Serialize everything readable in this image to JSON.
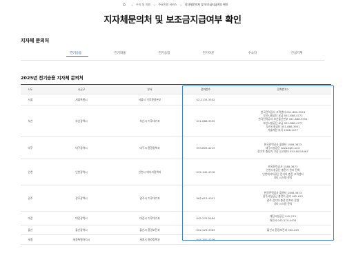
{
  "breadcrumb": {
    "home_icon": "⌂",
    "items": [
      "우리 동 지원",
      "주요민원 서비스",
      "지자체문의처 및 보조금지급여부 확인"
    ]
  },
  "page_title": "지자체문의처 및 보조금지급여부 확인",
  "section_title": "지자체 문의처",
  "tabs": [
    {
      "label": "전기승용",
      "active": true
    },
    {
      "label": "전기화물",
      "active": false
    },
    {
      "label": "전기승합",
      "active": false
    },
    {
      "label": "전기이륜",
      "active": false
    },
    {
      "label": "수소차",
      "active": false
    },
    {
      "label": "건설기계",
      "active": false
    }
  ],
  "table_title": "2025년 전기승용 지자체 문의처",
  "columns": [
    "시도",
    "시군구",
    "부서",
    "전화번호",
    "전화번호2"
  ],
  "rows": [
    {
      "area": "서울",
      "org": "서울특별시",
      "dept": "서울시 기후환경본부",
      "phone": "02-2133-3552",
      "elec": [
        ""
      ]
    },
    {
      "area": "부산",
      "org": "부산광역시",
      "dept": "부산시 기후대기과",
      "phone": "051-888-3552",
      "elec": [
        "한국전력공사 고객센터 051-880-3554",
        "부산시설공단 요금 051-888-4772",
        "한국전력공사 부산울산본부 051-888-3554",
        "부산시설공단 요금 051-888-4777",
        "부산시설공단 051-888-3951",
        "기술지원 부서 1588-1177"
      ]
    },
    {
      "area": "대구",
      "org": "대구광역시",
      "dept": "대구시 환경정책과",
      "phone": "053-803-4213",
      "elec": [
        "한국전력공사 콜센터 1588-3873",
        "대구시설공단 www.dgfc.or.kr",
        "전기차 충전기 고장 신고센터 053-803-8467"
      ]
    },
    {
      "area": "인천",
      "org": "인천광역시",
      "dept": "인천시 에너지정책과",
      "phone": "032-440-4316",
      "elec": [
        "한국전력공사 1588-3873",
        "인천시설공단 충전기 관리 전화",
        "인천에너지공단 전기차 충전 고객센터",
        "기타 시스템 문의"
      ]
    },
    {
      "area": "광주",
      "org": "광주광역시",
      "dept": "광주시 기후대기과",
      "phone": "062-613-4341",
      "elec": [
        "한국전력공사 콜센터 1588-3873",
        "광주시설공단 충전기 관리 062-613",
        "광주 전기차 충전 인프라 운영",
        "기타 시스템 문의"
      ]
    },
    {
      "area": "대전",
      "org": "대전광역시",
      "dept": "대전시 기후대기과",
      "phone": "042-270-5484",
      "elec": [
        "대전시설공단 042-270",
        "대전시 042-270-4434"
      ]
    },
    {
      "area": "울산",
      "org": "울산광역시",
      "dept": "울산시 환경보전과",
      "phone": "052-229-3383",
      "elec": [
        "울산시 환경보전과 052-229"
      ]
    },
    {
      "area": "세종",
      "org": "세종특별자치시",
      "dept": "세종시 환경정책과",
      "phone": "044-300-4236",
      "elec": [
        ""
      ]
    }
  ],
  "colors": {
    "accent": "#1b63c6",
    "highlight_border": "#3b82d6"
  }
}
